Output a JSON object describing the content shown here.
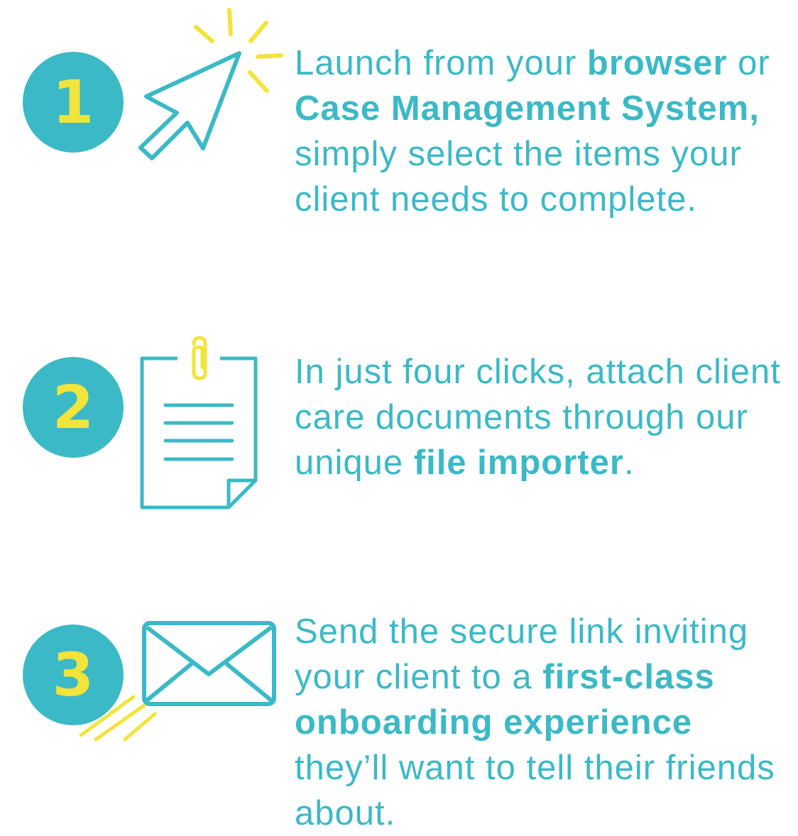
{
  "colors": {
    "teal": "#3bb9c6",
    "yellow": "#f2e43a",
    "background": "#ffffff"
  },
  "steps": [
    {
      "number": "1",
      "icon": "cursor-click-icon",
      "text": [
        {
          "t": "Launch from your ",
          "bold": false
        },
        {
          "t": "browser",
          "bold": true
        },
        {
          "t": " or ",
          "bold": false
        },
        {
          "t": "Case Management System,",
          "bold": true
        },
        {
          "t": " simply select the items your client needs to complete.",
          "bold": false
        }
      ]
    },
    {
      "number": "2",
      "icon": "document-paperclip-icon",
      "text": [
        {
          "t": "In just four clicks, attach client care documents through our unique ",
          "bold": false
        },
        {
          "t": "file importer",
          "bold": true
        },
        {
          "t": ".",
          "bold": false
        }
      ]
    },
    {
      "number": "3",
      "icon": "envelope-icon",
      "text": [
        {
          "t": "Send the secure link inviting your client to a ",
          "bold": false
        },
        {
          "t": "first-class onboarding experience",
          "bold": true
        },
        {
          "t": " they’ll want to tell their friends about.",
          "bold": false
        }
      ]
    }
  ]
}
